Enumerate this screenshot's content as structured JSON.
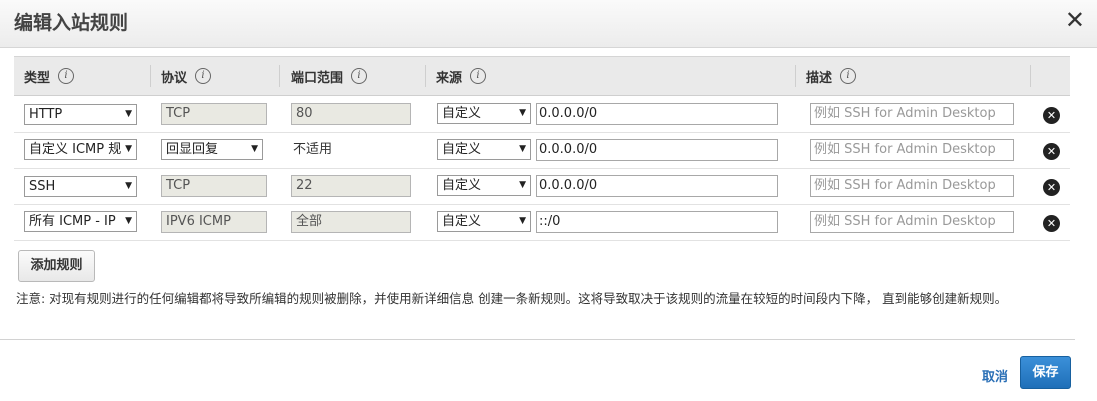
{
  "dialog": {
    "title": "编辑入站规则",
    "close_icon": "close-icon"
  },
  "columns": {
    "type": "类型",
    "protocol": "协议",
    "port_range": "端口范围",
    "source": "来源",
    "description": "描述",
    "info_icon": "i"
  },
  "rows": [
    {
      "type": "HTTP",
      "protocol": "TCP",
      "protocol_editable": false,
      "port": "80",
      "source_mode": "自定义",
      "source_cidr": "0.0.0.0/0",
      "description_placeholder": "例如 SSH for Admin Desktop"
    },
    {
      "type": "自定义 ICMP 规",
      "protocol": "回显回复",
      "protocol_editable": true,
      "port": "不适用",
      "source_mode": "自定义",
      "source_cidr": "0.0.0.0/0",
      "description_placeholder": "例如 SSH for Admin Desktop"
    },
    {
      "type": "SSH",
      "protocol": "TCP",
      "protocol_editable": false,
      "port": "22",
      "source_mode": "自定义",
      "source_cidr": "0.0.0.0/0",
      "description_placeholder": "例如 SSH for Admin Desktop"
    },
    {
      "type": "所有 ICMP - IP",
      "protocol": "IPV6 ICMP",
      "protocol_editable": false,
      "port": "全部",
      "source_mode": "自定义",
      "source_cidr": "::/0",
      "description_placeholder": "例如 SSH for Admin Desktop"
    }
  ],
  "actions": {
    "add_rule": "添加规则",
    "cancel": "取消",
    "save": "保存"
  },
  "note": "注意: 对现有规则进行的任何编辑都将导致所编辑的规则被删除，并使用新详细信息 创建一条新规则。这将导致取决于该规则的流量在较短的时间段内下降， 直到能够创建新规则。",
  "colors": {
    "primary_button": "#1f6fb8",
    "link": "#2a6fb6",
    "header_bg": "#eaeaea"
  }
}
